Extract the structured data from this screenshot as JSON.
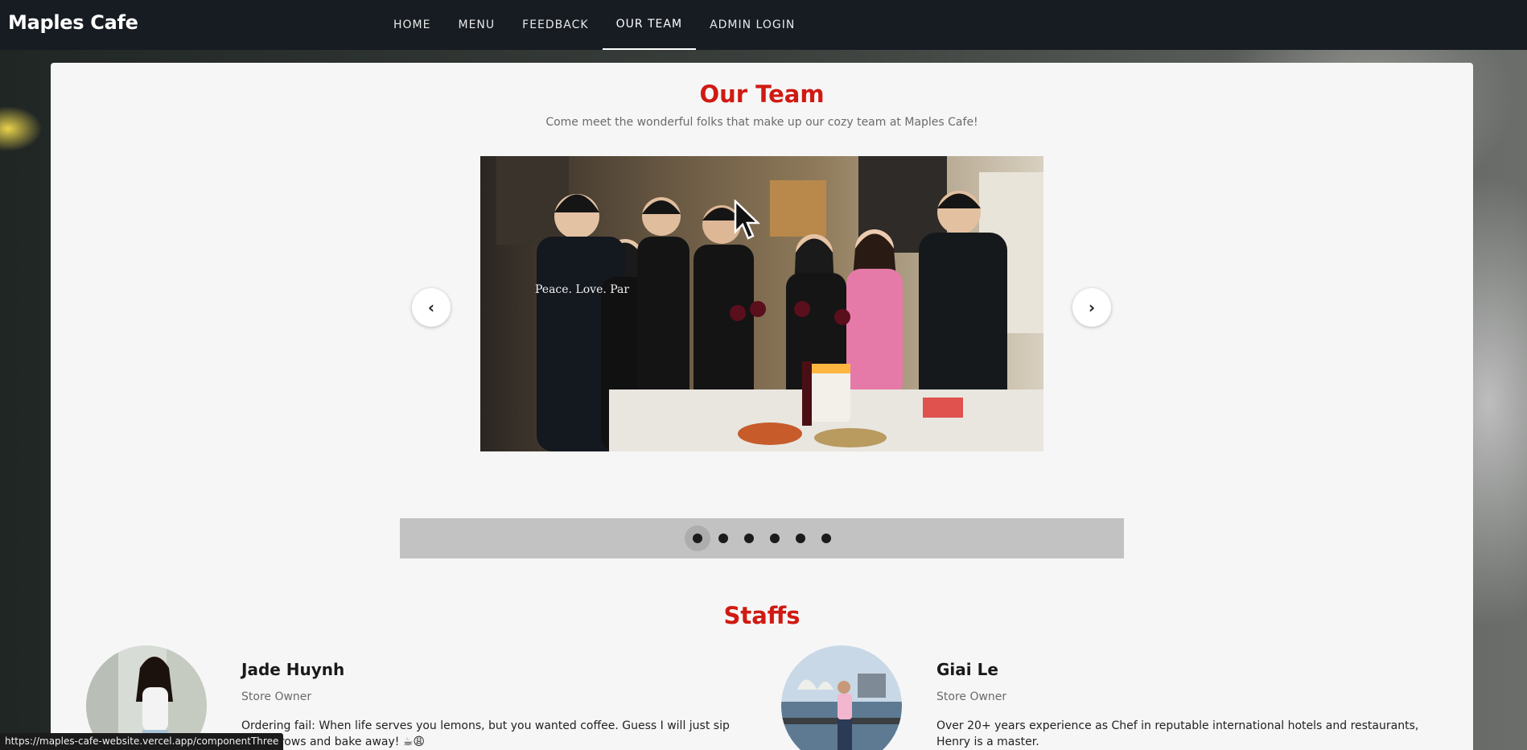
{
  "brand": "Maples Cafe",
  "nav": [
    {
      "label": "HOME",
      "active": false
    },
    {
      "label": "MENU",
      "active": false
    },
    {
      "label": "FEEDBACK",
      "active": false
    },
    {
      "label": "OUR TEAM",
      "active": true
    },
    {
      "label": "ADMIN LOGIN",
      "active": false
    }
  ],
  "team": {
    "title": "Our Team",
    "subtitle": "Come meet the wonderful folks that make up our cozy team at Maples Cafe!",
    "carousel": {
      "prev_icon": "chevron-left-icon",
      "next_icon": "chevron-right-icon",
      "slide_count": 6,
      "active_index": 0
    }
  },
  "staffs": {
    "title": "Staffs",
    "members": [
      {
        "name": "Jade Huynh",
        "role": "Store Owner",
        "bio": "Ordering fail: When life serves you lemons, but you wanted coffee. Guess I will just sip my sorrows and bake away! ☕😩"
      },
      {
        "name": "Giai Le",
        "role": "Store Owner",
        "bio": "Over 20+ years experience as Chef in reputable international hotels and restaurants, Henry is a master."
      }
    ]
  },
  "status_bar": {
    "url": "https://maples-cafe-website.vercel.app/componentThree"
  },
  "colors": {
    "accent": "#d01a12",
    "navbar": "#171c23"
  }
}
